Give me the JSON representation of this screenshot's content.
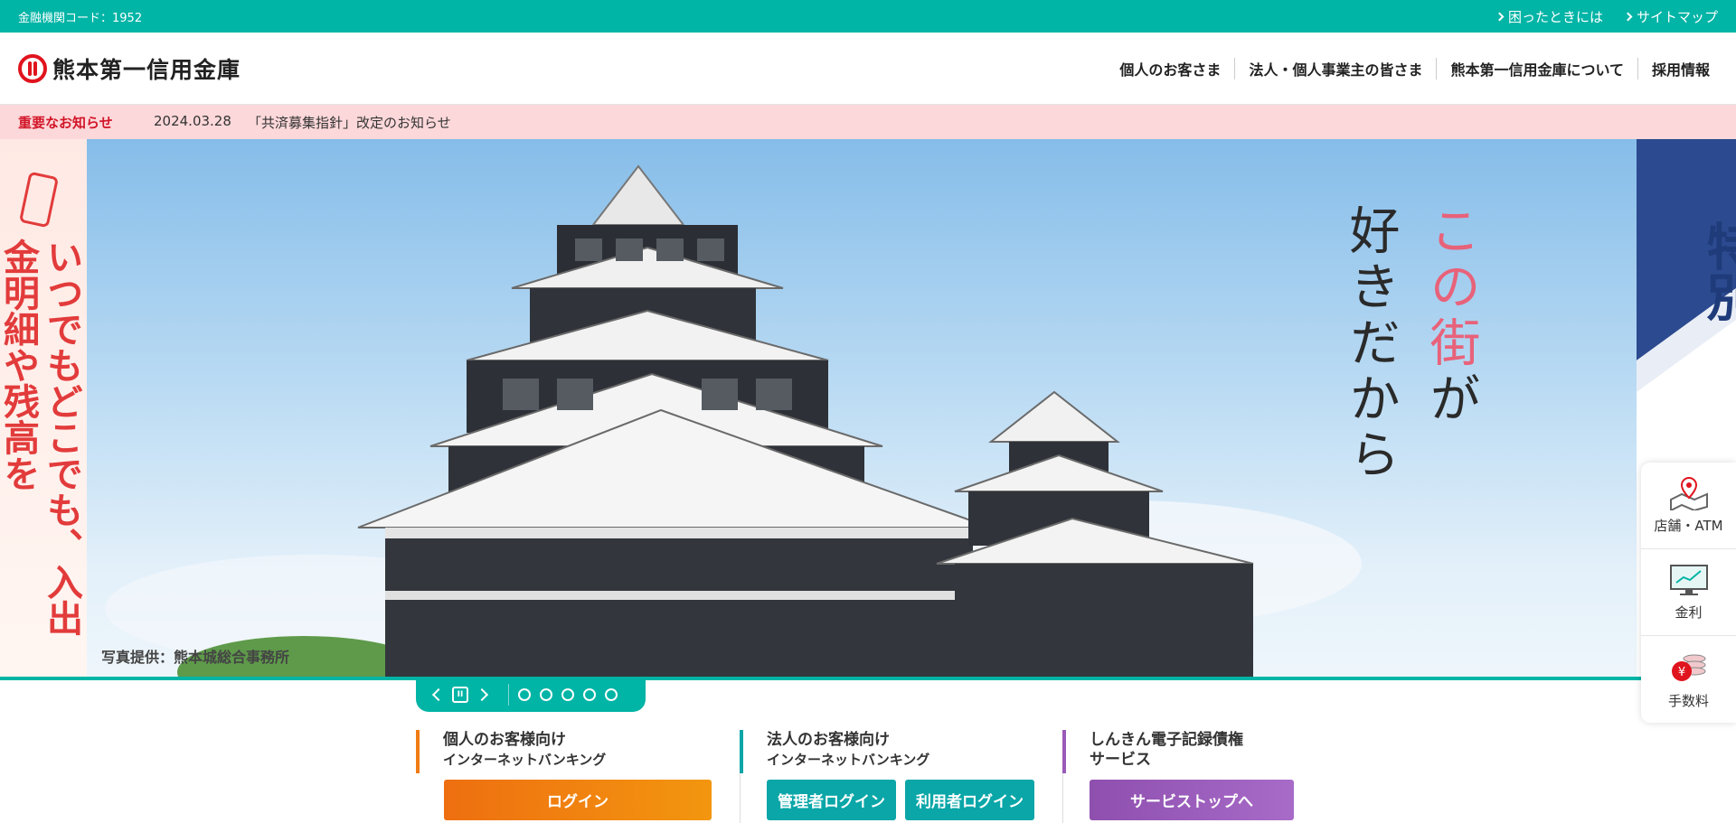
{
  "topbar": {
    "code_label": "金融機関コード：1952",
    "links": [
      "困ったときには",
      "サイトマップ"
    ]
  },
  "header": {
    "logo_text": "熊本第一信用金庫",
    "nav": [
      "個人のお客さま",
      "法人・個人事業主の皆さま",
      "熊本第一信用金庫について",
      "採用情報"
    ]
  },
  "notice": {
    "label": "重要なお知らせ",
    "date": "2024.03.28",
    "title": "「共済募集指針」改定のお知らせ"
  },
  "hero": {
    "left_text": "いつでもどこでも、入出金明細や残高を",
    "catch_line1_a": "この街",
    "catch_line1_b": "が",
    "catch_line2": "好きだから",
    "credit": "写真提供：熊本城総合事務所",
    "right_text": "特別"
  },
  "slider": {
    "pause_label": "II",
    "dots": 5,
    "active_index": 0
  },
  "side_menu": [
    {
      "label": "店舗・ATM",
      "icon": "map-pin-icon"
    },
    {
      "label": "金利",
      "icon": "rate-chart-icon"
    },
    {
      "label": "手数料",
      "icon": "yen-coins-icon"
    }
  ],
  "login_blocks": [
    {
      "title_line1": "個人のお客様向け",
      "title_line2": "インターネットバンキング",
      "buttons": [
        "ログイン"
      ],
      "color": "#f07b14"
    },
    {
      "title_line1": "法人のお客様向け",
      "title_line2": "インターネットバンキング",
      "buttons": [
        "管理者ログイン",
        "利用者ログイン"
      ],
      "color": "#0aa6a8"
    },
    {
      "title_line1": "しんきん電子記録債権",
      "title_line2": "サービス",
      "buttons": [
        "サービストップへ"
      ],
      "color": "#9a5ab8"
    }
  ],
  "colors": {
    "accent": "#00b4a6",
    "notice_bg": "#fdd8da",
    "notice_label": "#d21528",
    "brand_red": "#e0141e"
  }
}
